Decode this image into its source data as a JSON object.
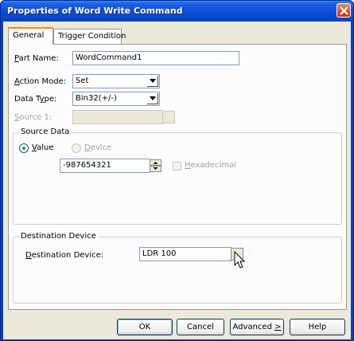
{
  "window": {
    "title": "Properties of Word Write Command"
  },
  "tabs": [
    {
      "label": "General",
      "active": true
    },
    {
      "label": "Trigger Condition",
      "active": false
    }
  ],
  "general": {
    "part_name": {
      "label_prefix": "",
      "label_underline": "P",
      "label_rest": "art Name:",
      "value": "WordCommand1"
    },
    "action_mode": {
      "label_underline": "A",
      "label_rest": "ction Mode:",
      "value": "Set"
    },
    "data_type": {
      "label_pre": "Data T",
      "label_underline": "y",
      "label_rest": "pe:",
      "value": "Bin32(+/-)"
    },
    "source1": {
      "label_underline": "S",
      "label_rest": "ource 1:",
      "value": ""
    }
  },
  "source_data": {
    "group_title": "Source Data",
    "value_radio": {
      "label_underline": "V",
      "label_rest": "alue",
      "checked": true
    },
    "device_radio": {
      "label_pre": "",
      "label_underline": "D",
      "label_rest": "evice",
      "checked": false
    },
    "value": "-987654321",
    "hexadecimal": {
      "label_underline": "H",
      "label_rest": "exadecimal",
      "checked": false
    }
  },
  "destination": {
    "group_title": "Destination Device",
    "label_underline": "D",
    "label_rest": "estination Device:",
    "value": "LDR 100"
  },
  "buttons": {
    "ok": "OK",
    "cancel": "Cancel",
    "advanced_pre": "Advanced ",
    "advanced_underline": ">",
    "help": "Help"
  },
  "colors": {
    "titlebar": "#0d4fd8",
    "dialog_bg": "#ece9d8",
    "tab_accent": "#e68b2c"
  }
}
